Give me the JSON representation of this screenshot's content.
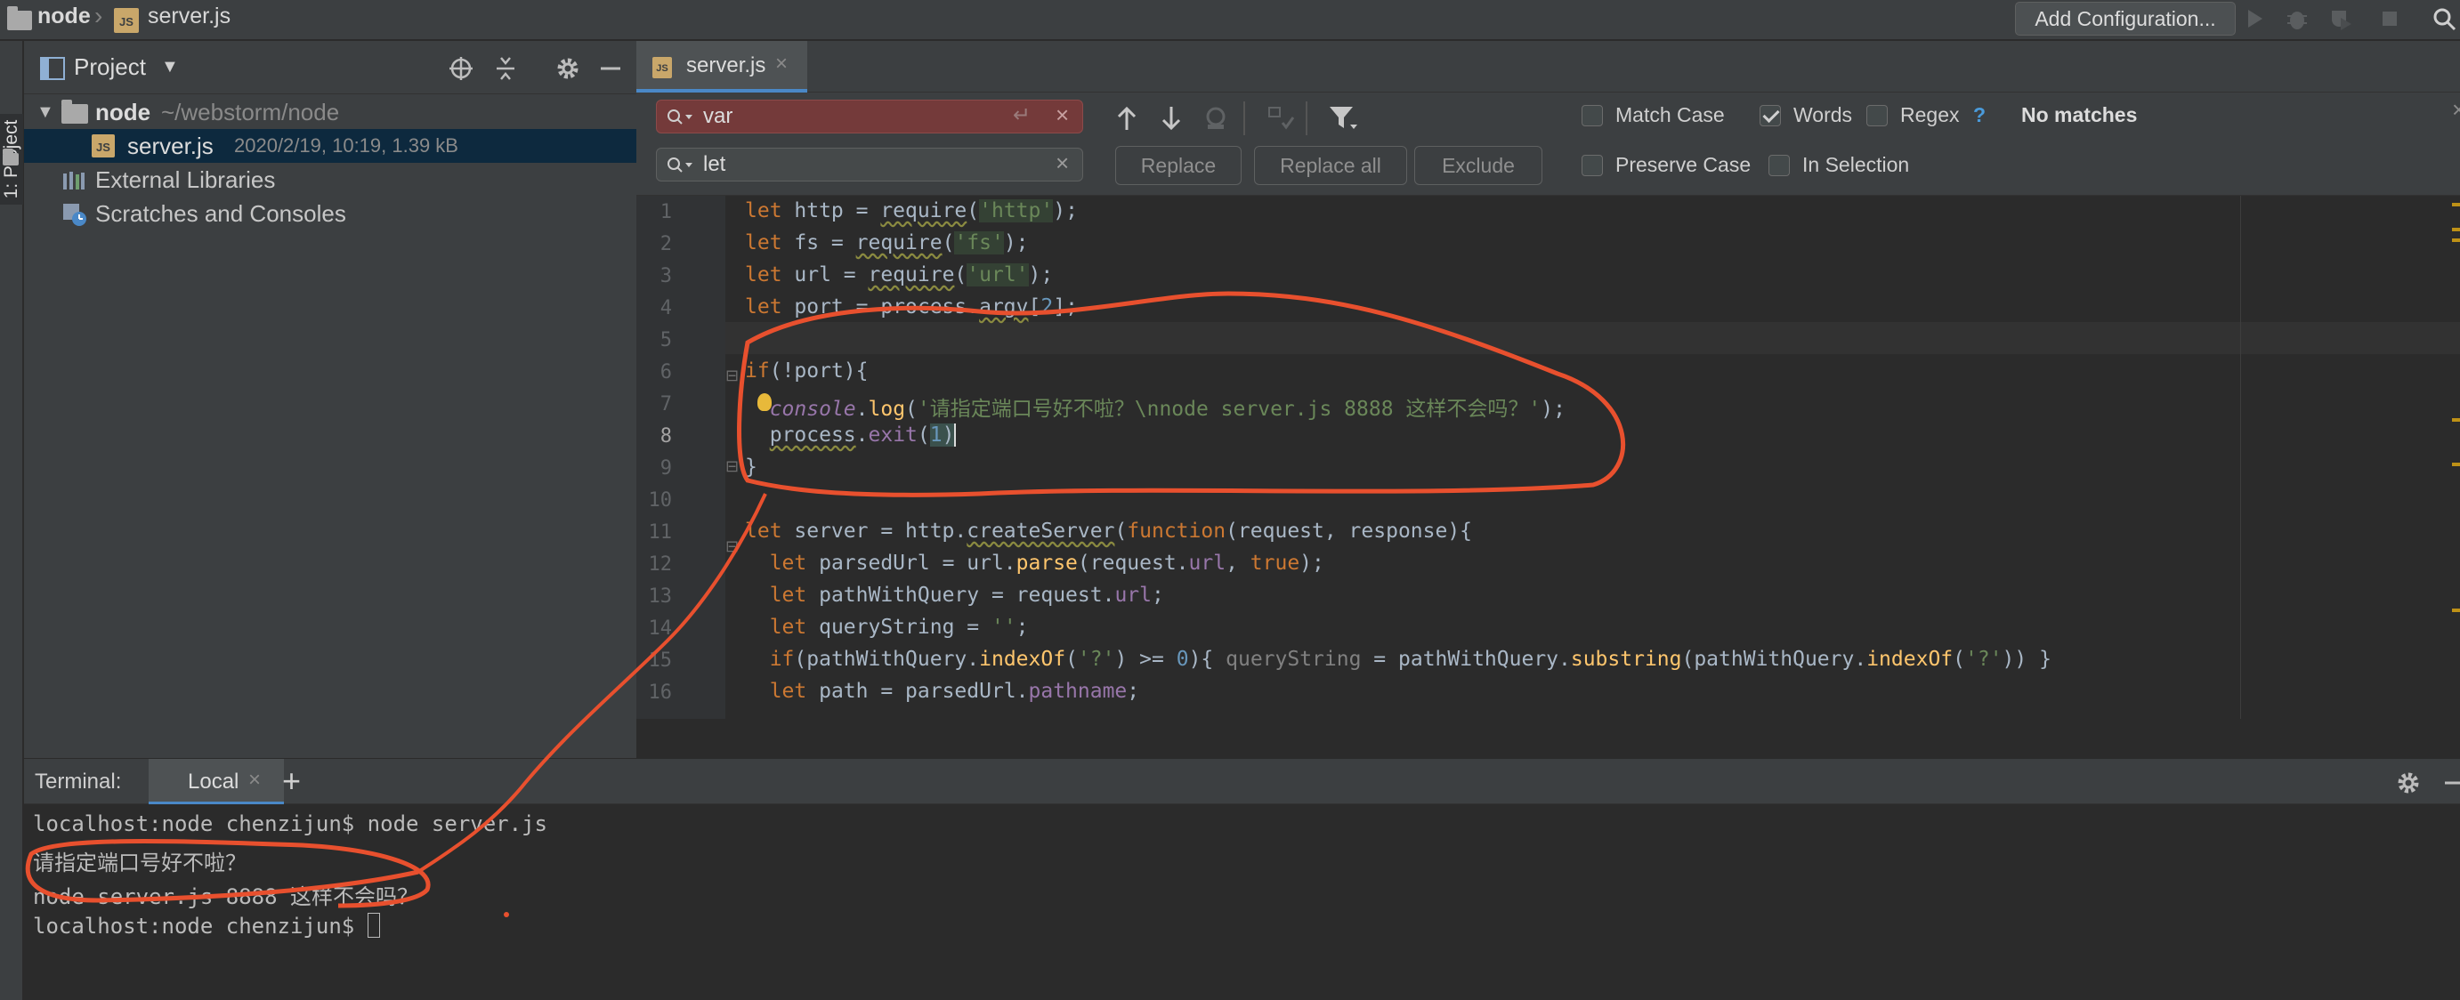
{
  "navbar": {
    "project_name": "node",
    "file_name": "server.js",
    "add_config_label": "Add Configuration..."
  },
  "left_strip": {
    "tab_label": "1: Project"
  },
  "project_panel": {
    "title": "Project",
    "root": {
      "name": "node",
      "path": "~/webstorm/node"
    },
    "file": {
      "name": "server.js",
      "meta": "2020/2/19, 10:19, 1.39 kB"
    },
    "external_libraries": "External Libraries",
    "scratches": "Scratches and Consoles"
  },
  "editor_tab": {
    "label": "server.js",
    "icon_text": "JS"
  },
  "find": {
    "search_value": "var",
    "replace_value": "let",
    "replace_label": "Replace",
    "replace_all_label": "Replace all",
    "exclude_label": "Exclude",
    "match_case_label": "Match Case",
    "words_label": "Words",
    "regex_label": "Regex",
    "regex_help": "?",
    "preserve_case_label": "Preserve Case",
    "in_selection_label": "In Selection",
    "status": "No matches",
    "options": {
      "match_case": false,
      "words": true,
      "regex": false,
      "preserve_case": false,
      "in_selection": false
    }
  },
  "editor": {
    "current_line": 8,
    "line_numbers": [
      "1",
      "2",
      "3",
      "4",
      "5",
      "6",
      "7",
      "8",
      "9",
      "10",
      "11",
      "12",
      "13",
      "14",
      "15",
      "16"
    ]
  },
  "terminal": {
    "header_label": "Terminal:",
    "tab_label": "Local",
    "lines": [
      "localhost:node chenzijun$ node server.js",
      "请指定端口号好不啦？",
      "node server.js 8888 这样不会吗？",
      "localhost:node chenzijun$ "
    ]
  },
  "colors": {
    "accent": "#4a88c7",
    "search_error_bg": "#743a3a",
    "annotation": "#e8502e"
  }
}
